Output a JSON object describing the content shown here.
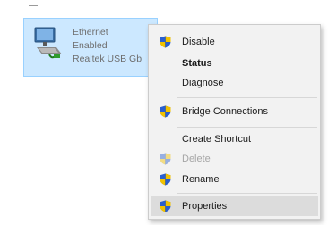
{
  "adapter": {
    "name": "Ethernet",
    "status": "Enabled",
    "device": "Realtek USB Gb"
  },
  "context_menu": {
    "items": [
      {
        "label": "Disable",
        "icon": "uac-shield-icon"
      },
      {
        "label": "Status"
      },
      {
        "label": "Diagnose"
      },
      {
        "label": "Bridge Connections",
        "icon": "uac-shield-icon"
      },
      {
        "label": "Create Shortcut"
      },
      {
        "label": "Delete",
        "icon": "uac-shield-icon",
        "disabled": true
      },
      {
        "label": "Rename",
        "icon": "uac-shield-icon"
      },
      {
        "label": "Properties",
        "icon": "uac-shield-icon",
        "highlighted": true
      }
    ]
  },
  "colors": {
    "selection": "#cce8ff",
    "selection_border": "#99d1ff",
    "menu_bg": "#f2f2f2",
    "highlight": "#dcdcdc",
    "disabled_text": "#a6a6a6"
  }
}
